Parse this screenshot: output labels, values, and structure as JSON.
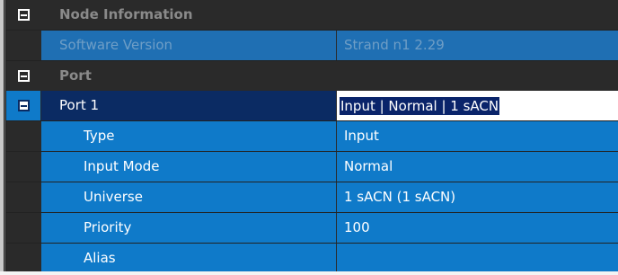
{
  "grid": {
    "categories": {
      "node_information": "Node Information",
      "port": "Port"
    },
    "software_version": {
      "name": "Software Version",
      "value": "Strand n1 2.29"
    },
    "port_1": {
      "name": "Port 1",
      "value": "Input | Normal | 1 sACN"
    },
    "properties": {
      "type": {
        "name": "Type",
        "value": "Input"
      },
      "input_mode": {
        "name": "Input Mode",
        "value": "Normal"
      },
      "universe": {
        "name": "Universe",
        "value": "1 sACN (1 sACN)"
      },
      "priority": {
        "name": "Priority",
        "value": "100"
      },
      "alias": {
        "name": "Alias",
        "value": ""
      }
    }
  },
  "colors": {
    "category_bg": "#2a2a2a",
    "property_bg": "#0f7ac9",
    "selected_bg": "#0b2b63",
    "edit_bg": "#ffffff"
  },
  "icons": {
    "expand_toggle": "collapse-box-icon"
  }
}
